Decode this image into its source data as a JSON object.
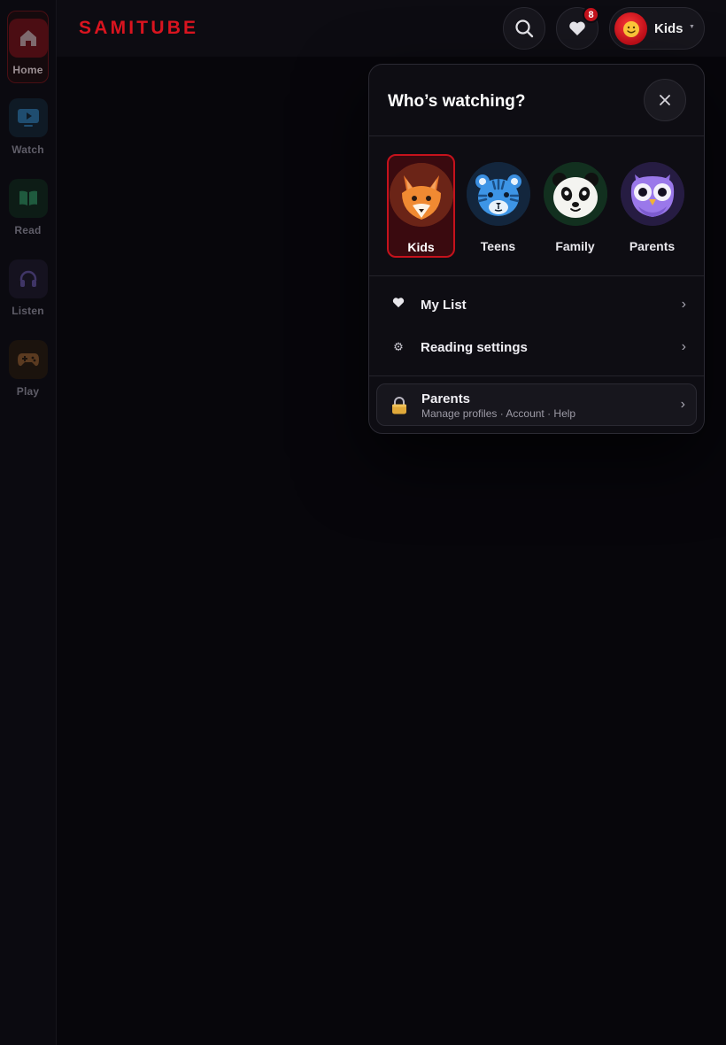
{
  "app": {
    "logo": "SAMITUBE"
  },
  "sidebar": {
    "items": [
      {
        "label": "Home",
        "icon": "home-icon",
        "active": true
      },
      {
        "label": "Watch",
        "icon": "tv-icon",
        "active": false
      },
      {
        "label": "Read",
        "icon": "book-icon",
        "active": false
      },
      {
        "label": "Listen",
        "icon": "headphones-icon",
        "active": false
      },
      {
        "label": "Play",
        "icon": "gamepad-icon",
        "active": false
      }
    ]
  },
  "header": {
    "favorites_count": "8",
    "current_profile": "Kids",
    "icons": [
      "search-icon",
      "heart-icon",
      "caret-down-icon"
    ]
  },
  "popover": {
    "title": "Who’s watching?",
    "profiles": [
      {
        "name": "Kids",
        "avatar": "fox-icon",
        "selected": true
      },
      {
        "name": "Teens",
        "avatar": "tiger-icon",
        "selected": false
      },
      {
        "name": "Family",
        "avatar": "panda-icon",
        "selected": false
      },
      {
        "name": "Parents",
        "avatar": "owl-icon",
        "selected": false
      }
    ],
    "menu": [
      {
        "label": "My List",
        "icon": "heart-icon"
      },
      {
        "label": "Reading settings",
        "icon": "gear-icon"
      }
    ],
    "parents": {
      "title": "Parents",
      "subtitle": "Manage profiles · Account · Help",
      "icon": "lock-icon"
    }
  },
  "colors": {
    "accent": "#d9141f",
    "background": "#07060b",
    "panel": "#0e0d13"
  }
}
